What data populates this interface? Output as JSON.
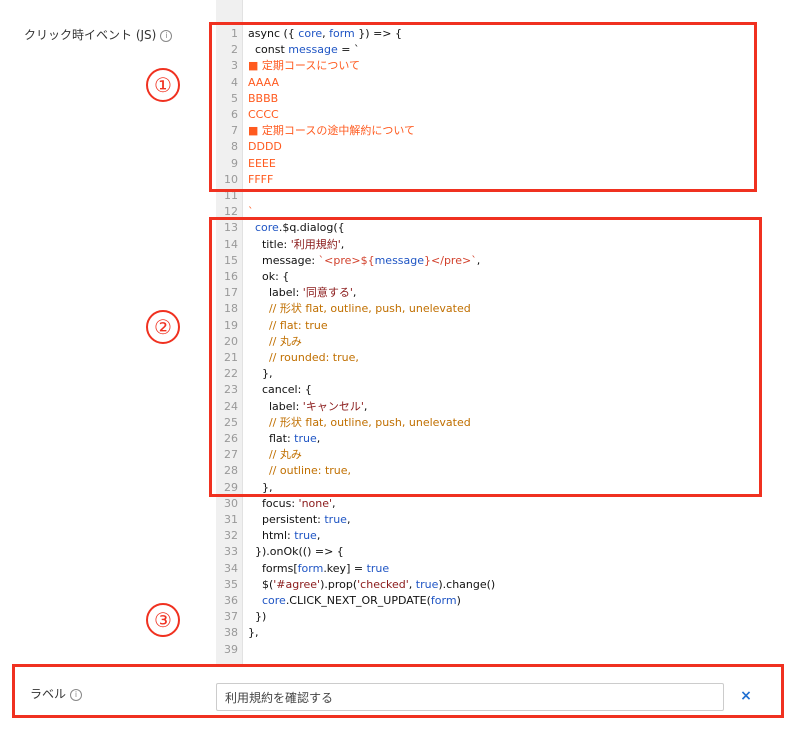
{
  "js_field": {
    "label": "クリック時イベント (JS)",
    "info_icon": "i"
  },
  "code_lines": [
    {
      "n": "1",
      "spans": [
        {
          "t": "async ({ ",
          "c": "c-default"
        },
        {
          "t": "core",
          "c": "c-blue"
        },
        {
          "t": ", ",
          "c": "c-default"
        },
        {
          "t": "form",
          "c": "c-blue"
        },
        {
          "t": " }) => {",
          "c": "c-default"
        }
      ]
    },
    {
      "n": "2",
      "spans": [
        {
          "t": "  const ",
          "c": "c-default"
        },
        {
          "t": "message",
          "c": "c-blue"
        },
        {
          "t": " = `",
          "c": "c-default"
        }
      ]
    },
    {
      "n": "3",
      "spans": [
        {
          "t": "■ 定期コースについて",
          "c": "c-orange"
        }
      ]
    },
    {
      "n": "4",
      "spans": [
        {
          "t": "AAAA",
          "c": "c-orange"
        }
      ]
    },
    {
      "n": "5",
      "spans": [
        {
          "t": "BBBB",
          "c": "c-orange"
        }
      ]
    },
    {
      "n": "6",
      "spans": [
        {
          "t": "CCCC",
          "c": "c-orange"
        }
      ]
    },
    {
      "n": "7",
      "spans": [
        {
          "t": "■ 定期コースの途中解約について",
          "c": "c-orange"
        }
      ]
    },
    {
      "n": "8",
      "spans": [
        {
          "t": "DDDD",
          "c": "c-orange"
        }
      ]
    },
    {
      "n": "9",
      "spans": [
        {
          "t": "EEEE",
          "c": "c-orange"
        }
      ]
    },
    {
      "n": "10",
      "spans": [
        {
          "t": "FFFF",
          "c": "c-orange"
        }
      ]
    },
    {
      "n": "11",
      "spans": []
    },
    {
      "n": "12",
      "spans": [
        {
          "t": "`",
          "c": "c-orange"
        }
      ]
    },
    {
      "n": "13",
      "spans": [
        {
          "t": "  core",
          "c": "c-blue"
        },
        {
          "t": ".$q.dialog({",
          "c": "c-default"
        }
      ]
    },
    {
      "n": "14",
      "spans": [
        {
          "t": "    title: ",
          "c": "c-default"
        },
        {
          "t": "'利用規約'",
          "c": "c-string"
        },
        {
          "t": ",",
          "c": "c-default"
        }
      ]
    },
    {
      "n": "15",
      "spans": [
        {
          "t": "    message: ",
          "c": "c-default"
        },
        {
          "t": "`<pre>${",
          "c": "c-template"
        },
        {
          "t": "message",
          "c": "c-blue"
        },
        {
          "t": "}</pre>`",
          "c": "c-template"
        },
        {
          "t": ",",
          "c": "c-default"
        }
      ]
    },
    {
      "n": "16",
      "spans": [
        {
          "t": "    ok: {",
          "c": "c-default"
        }
      ]
    },
    {
      "n": "17",
      "spans": [
        {
          "t": "      label: ",
          "c": "c-default"
        },
        {
          "t": "'同意する'",
          "c": "c-string"
        },
        {
          "t": ",",
          "c": "c-default"
        }
      ]
    },
    {
      "n": "18",
      "spans": [
        {
          "t": "      // 形状 flat, outline, push, unelevated",
          "c": "c-comment"
        }
      ]
    },
    {
      "n": "19",
      "spans": [
        {
          "t": "      // flat: true",
          "c": "c-comment"
        }
      ]
    },
    {
      "n": "20",
      "spans": [
        {
          "t": "      // 丸み",
          "c": "c-comment"
        }
      ]
    },
    {
      "n": "21",
      "spans": [
        {
          "t": "      // rounded: true,",
          "c": "c-comment"
        }
      ]
    },
    {
      "n": "22",
      "spans": [
        {
          "t": "    },",
          "c": "c-default"
        }
      ]
    },
    {
      "n": "23",
      "spans": [
        {
          "t": "    cancel: {",
          "c": "c-default"
        }
      ]
    },
    {
      "n": "24",
      "spans": [
        {
          "t": "      label: ",
          "c": "c-default"
        },
        {
          "t": "'キャンセル'",
          "c": "c-string"
        },
        {
          "t": ",",
          "c": "c-default"
        }
      ]
    },
    {
      "n": "25",
      "spans": [
        {
          "t": "      // 形状 flat, outline, push, unelevated",
          "c": "c-comment"
        }
      ]
    },
    {
      "n": "26",
      "spans": [
        {
          "t": "      flat: ",
          "c": "c-default"
        },
        {
          "t": "true",
          "c": "c-blue"
        },
        {
          "t": ",",
          "c": "c-default"
        }
      ]
    },
    {
      "n": "27",
      "spans": [
        {
          "t": "      // 丸み",
          "c": "c-comment"
        }
      ]
    },
    {
      "n": "28",
      "spans": [
        {
          "t": "      // outline: true,",
          "c": "c-comment"
        }
      ]
    },
    {
      "n": "29",
      "spans": [
        {
          "t": "    },",
          "c": "c-default"
        }
      ]
    },
    {
      "n": "30",
      "spans": [
        {
          "t": "    focus: ",
          "c": "c-default"
        },
        {
          "t": "'none'",
          "c": "c-string"
        },
        {
          "t": ",",
          "c": "c-default"
        }
      ]
    },
    {
      "n": "31",
      "spans": [
        {
          "t": "    persistent: ",
          "c": "c-default"
        },
        {
          "t": "true",
          "c": "c-blue"
        },
        {
          "t": ",",
          "c": "c-default"
        }
      ]
    },
    {
      "n": "32",
      "spans": [
        {
          "t": "    html: ",
          "c": "c-default"
        },
        {
          "t": "true",
          "c": "c-blue"
        },
        {
          "t": ",",
          "c": "c-default"
        }
      ]
    },
    {
      "n": "33",
      "spans": [
        {
          "t": "  }).onOk(() => {",
          "c": "c-default"
        }
      ]
    },
    {
      "n": "34",
      "spans": [
        {
          "t": "    forms[",
          "c": "c-default"
        },
        {
          "t": "form",
          "c": "c-blue"
        },
        {
          "t": ".key] = ",
          "c": "c-default"
        },
        {
          "t": "true",
          "c": "c-blue"
        }
      ]
    },
    {
      "n": "35",
      "spans": [
        {
          "t": "    $(",
          "c": "c-default"
        },
        {
          "t": "'#agree'",
          "c": "c-string"
        },
        {
          "t": ").prop(",
          "c": "c-default"
        },
        {
          "t": "'checked'",
          "c": "c-string"
        },
        {
          "t": ", ",
          "c": "c-default"
        },
        {
          "t": "true",
          "c": "c-blue"
        },
        {
          "t": ").change()",
          "c": "c-default"
        }
      ]
    },
    {
      "n": "36",
      "spans": [
        {
          "t": "    core",
          "c": "c-blue"
        },
        {
          "t": ".CLICK_NEXT_OR_UPDATE(",
          "c": "c-default"
        },
        {
          "t": "form",
          "c": "c-blue"
        },
        {
          "t": ")",
          "c": "c-default"
        }
      ]
    },
    {
      "n": "37",
      "spans": [
        {
          "t": "  })",
          "c": "c-default"
        }
      ]
    },
    {
      "n": "38",
      "spans": [
        {
          "t": "},",
          "c": "c-default"
        }
      ]
    },
    {
      "n": "39",
      "spans": []
    }
  ],
  "annotations": {
    "one": "①",
    "two": "②",
    "three": "③"
  },
  "label_field": {
    "label": "ラベル",
    "info_icon": "i",
    "value": "利用規約を確認する",
    "clear": "×"
  },
  "colors": {
    "highlight_red": "#f03120",
    "accent_blue": "#1f6fd1"
  }
}
